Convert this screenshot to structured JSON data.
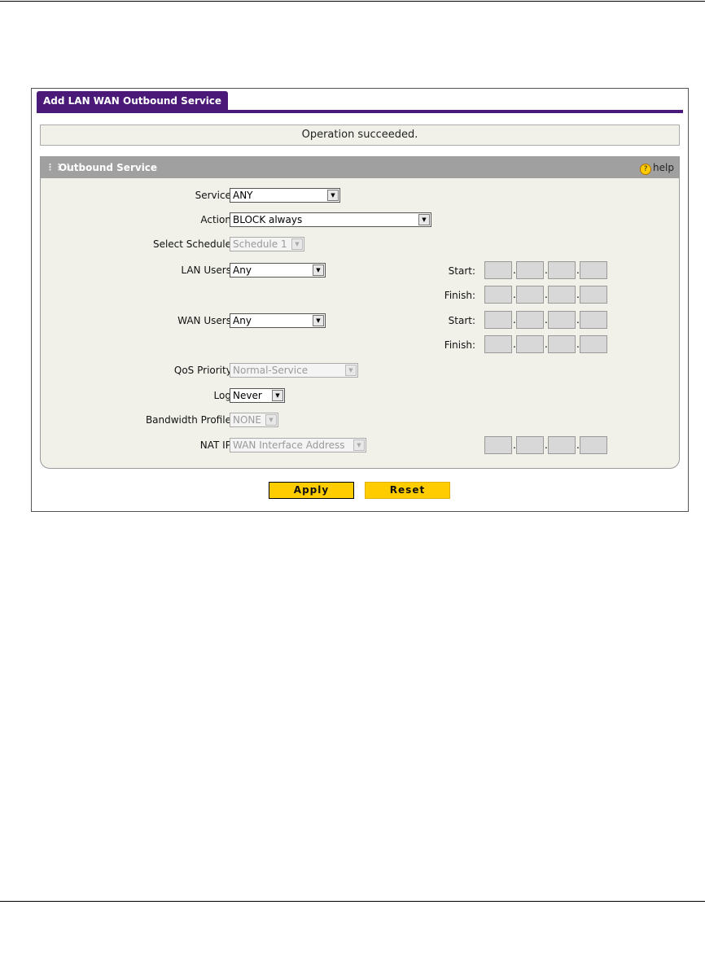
{
  "window": {
    "tab_title": "Add LAN WAN Outbound Service"
  },
  "status": {
    "message": "Operation succeeded."
  },
  "section": {
    "title": "Outbound Service",
    "help_label": "help",
    "help_icon": "help-icon"
  },
  "form": {
    "service": {
      "label": "Service:",
      "value": "ANY"
    },
    "action": {
      "label": "Action:",
      "value": "BLOCK always"
    },
    "schedule": {
      "label": "Select Schedule:",
      "value": "Schedule 1"
    },
    "lan_users": {
      "label": "LAN Users:",
      "value": "Any"
    },
    "wan_users": {
      "label": "WAN Users:",
      "value": "Any"
    },
    "qos": {
      "label": "QoS Priority:",
      "value": "Normal-Service"
    },
    "log": {
      "label": "Log:",
      "value": "Never"
    },
    "bandwidth": {
      "label": "Bandwidth Profile:",
      "value": "NONE"
    },
    "nat_ip": {
      "label": "NAT IP:",
      "value": "WAN Interface Address"
    }
  },
  "ip_labels": {
    "start": "Start:",
    "finish": "Finish:"
  },
  "buttons": {
    "apply": "Apply",
    "reset": "Reset"
  }
}
